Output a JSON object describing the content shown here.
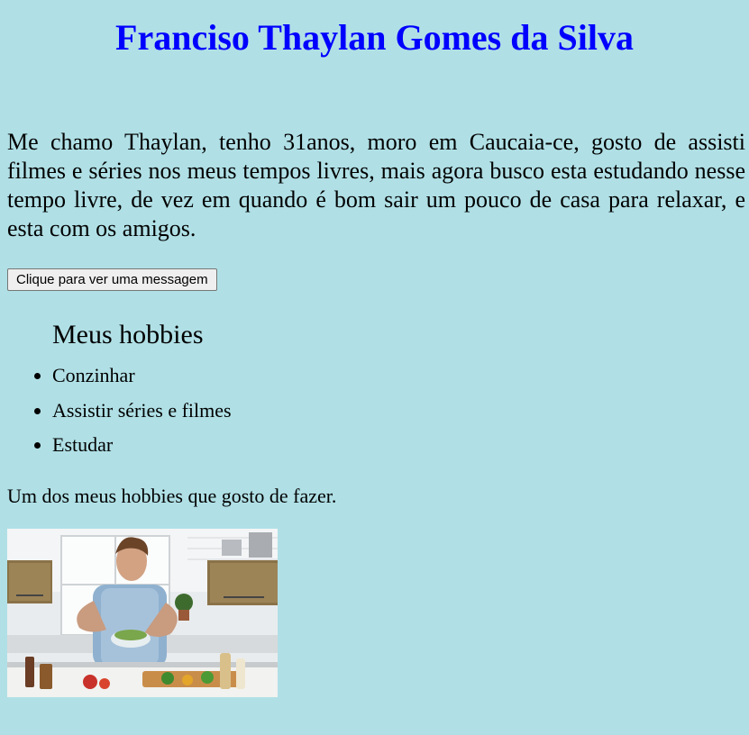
{
  "page": {
    "title": "Franciso Thaylan Gomes da Silva",
    "intro": "Me chamo Thaylan, tenho 31anos, moro em Caucaia-ce, gosto de assisti filmes e séries nos meus tempos livres, mais agora busco esta estudando nesse tempo livre, de vez em quando é bom sair um pouco de casa para relaxar, e esta com os amigos.",
    "button_label": "Clique para ver uma messagem",
    "hobbies_heading": "Meus hobbies",
    "hobbies": [
      "Conzinhar",
      "Assistir séries e filmes",
      "Estudar"
    ],
    "caption": "Um dos meus hobbies que gosto de fazer."
  },
  "colors": {
    "background": "#b0e0e6",
    "title": "#0000ff"
  }
}
